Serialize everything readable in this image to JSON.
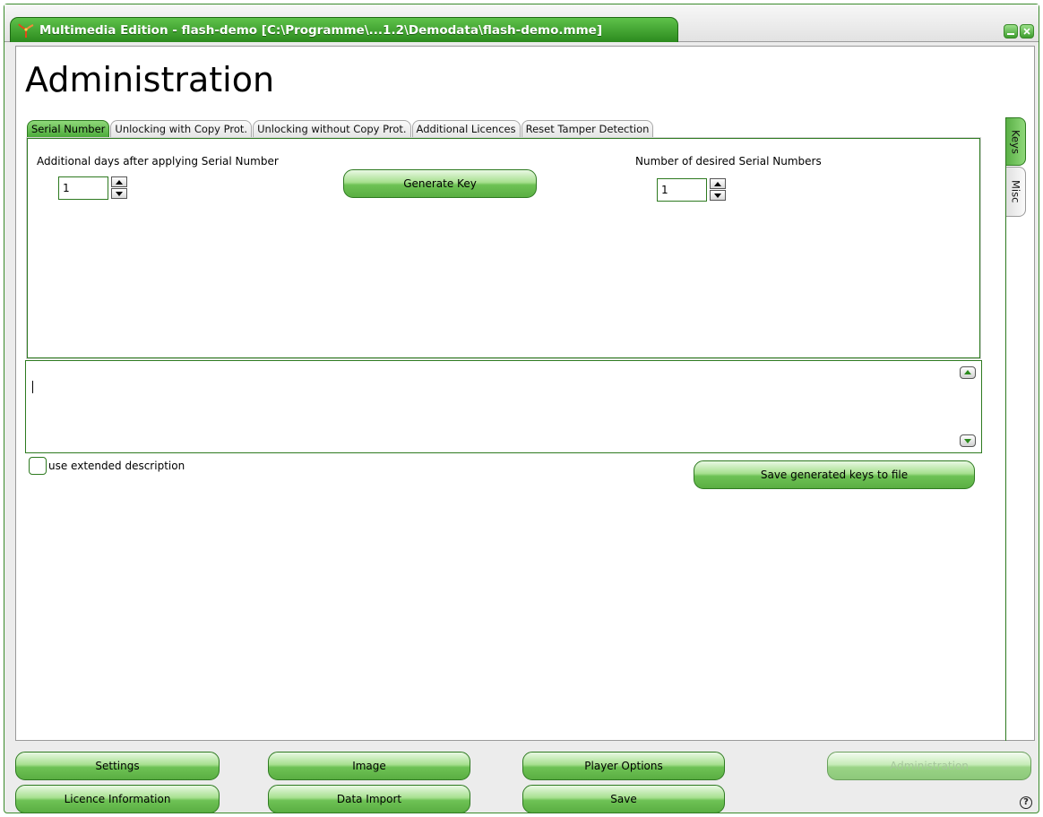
{
  "window": {
    "title": "Multimedia Edition - flash-demo [C:\\Programme\\...1.2\\Demodata\\flash-demo.mme]"
  },
  "page": {
    "title": "Administration"
  },
  "tabs": [
    {
      "label": "Serial Number",
      "active": true
    },
    {
      "label": "Unlocking with Copy Prot.",
      "active": false
    },
    {
      "label": "Unlocking without Copy Prot.",
      "active": false
    },
    {
      "label": "Additional Licences",
      "active": false
    },
    {
      "label": "Reset Tamper Detection",
      "active": false
    }
  ],
  "side_tabs": [
    {
      "label": "Keys",
      "active": true
    },
    {
      "label": "Misc",
      "active": false
    }
  ],
  "serial_panel": {
    "days_label": "Additional days after applying Serial Number",
    "days_value": "1",
    "generate_label": "Generate Key",
    "count_label": "Number of desired Serial Numbers",
    "count_value": "1"
  },
  "output": {
    "text": ""
  },
  "options": {
    "extended_label": "use extended description",
    "extended_checked": false,
    "save_keys_label": "Save generated keys to file"
  },
  "footer": {
    "settings": "Settings",
    "image": "Image",
    "player_options": "Player Options",
    "administration": "Administration",
    "licence_information": "Licence Information",
    "data_import": "Data Import",
    "save": "Save",
    "help": "?"
  },
  "colors": {
    "accent": "#2c8a1e",
    "accent_light": "#8fd87a",
    "disabled_text": "#a6c69c"
  }
}
